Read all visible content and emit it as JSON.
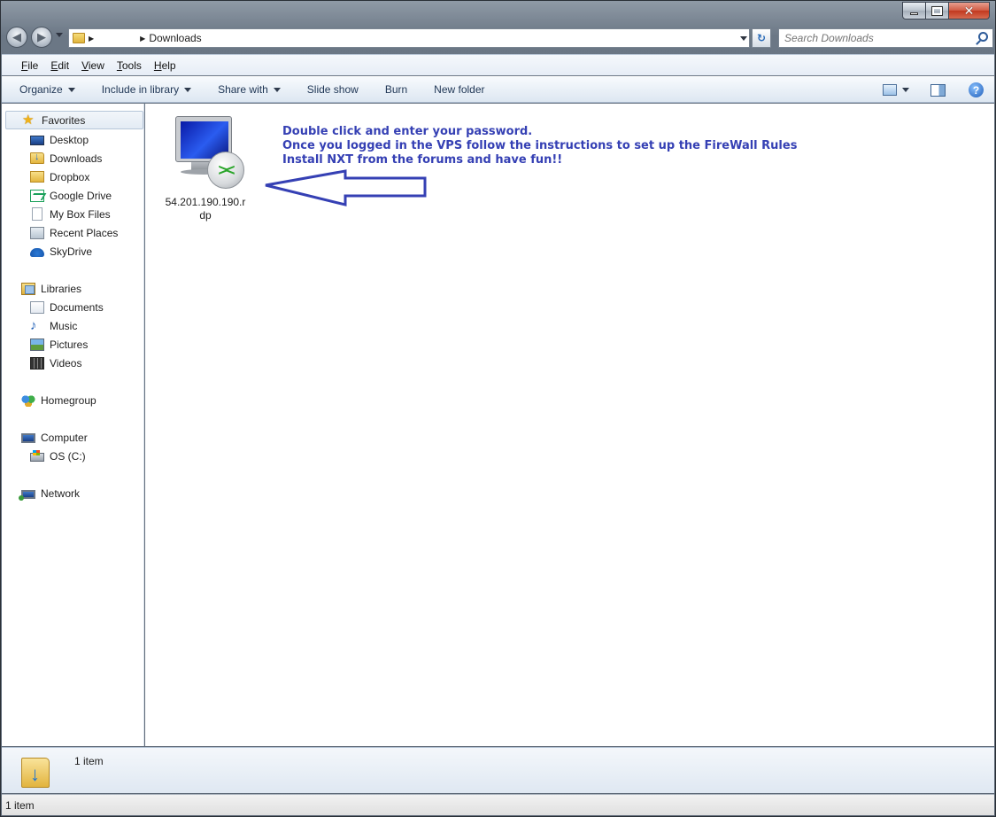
{
  "window": {
    "minimize_glyph": "—",
    "maximize_glyph": "□",
    "close_glyph": "✕"
  },
  "address_bar": {
    "crumb_text": "Downloads",
    "redacted_segment": ""
  },
  "search": {
    "placeholder": "Search Downloads"
  },
  "menu": {
    "items": [
      {
        "label": "File",
        "accel": "F",
        "rest": "ile"
      },
      {
        "label": "Edit",
        "accel": "E",
        "rest": "dit"
      },
      {
        "label": "View",
        "accel": "V",
        "rest": "iew"
      },
      {
        "label": "Tools",
        "accel": "T",
        "rest": "ools"
      },
      {
        "label": "Help",
        "accel": "H",
        "rest": "elp"
      }
    ]
  },
  "commands": {
    "organize": "Organize",
    "include_in_library": "Include in library",
    "share_with": "Share with",
    "slide_show": "Slide show",
    "burn": "Burn",
    "new_folder": "New folder",
    "help_glyph": "?"
  },
  "nav_pane": {
    "favorites": {
      "label": "Favorites",
      "items": [
        "Desktop",
        "Downloads",
        "Dropbox",
        "Google Drive",
        "My Box Files",
        "Recent Places",
        "SkyDrive"
      ]
    },
    "libraries": {
      "label": "Libraries",
      "items": [
        "Documents",
        "Music",
        "Pictures",
        "Videos"
      ]
    },
    "homegroup": "Homegroup",
    "computer": {
      "label": "Computer",
      "items": [
        "OS (C:)"
      ]
    },
    "network": "Network"
  },
  "content": {
    "files": [
      {
        "name": "54.201.190.190.rdp",
        "icon": "remote-desktop-icon"
      }
    ],
    "annotation": [
      "Double click and enter your password.",
      "Once you logged in the VPS follow the instructions to set up the FireWall Rules",
      "Install NXT from the forums and have fun!!"
    ],
    "annotation_color": "#3540b4"
  },
  "details_pane": {
    "count": "1 item"
  },
  "status_bar": {
    "count": "1 item"
  }
}
